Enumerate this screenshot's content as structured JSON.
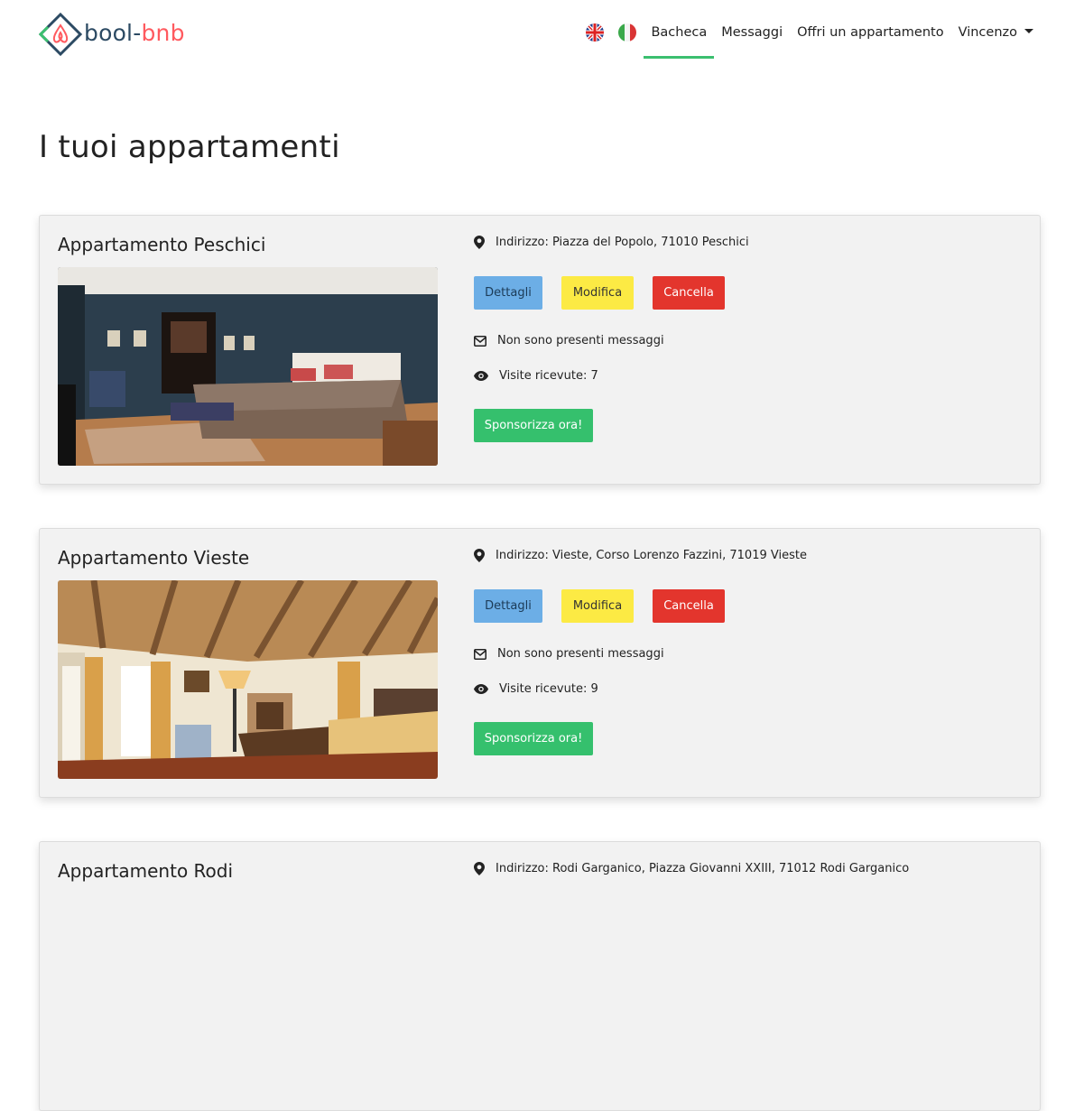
{
  "brand": {
    "part1": "bool",
    "dash": "-",
    "part2": "bnb"
  },
  "nav": {
    "flag_en": "uk-flag",
    "flag_it": "italy-flag",
    "bacheca": "Bacheca",
    "messaggi": "Messaggi",
    "offri": "Offri un appartamento",
    "user": "Vincenzo"
  },
  "page_title": "I tuoi appartamenti",
  "buttons": {
    "details": "Dettagli",
    "edit": "Modifica",
    "delete": "Cancella",
    "sponsor": "Sponsorizza ora!"
  },
  "apartments": [
    {
      "title": "Appartamento Peschici",
      "address": "Indirizzo: Piazza del Popolo, 71010 Peschici",
      "messages": "Non sono presenti messaggi",
      "visits": "Visite ricevute: 7"
    },
    {
      "title": "Appartamento Vieste",
      "address": "Indirizzo: Vieste, Corso Lorenzo Fazzini, 71019 Vieste",
      "messages": "Non sono presenti messaggi",
      "visits": "Visite ricevute: 9"
    },
    {
      "title": "Appartamento Rodi",
      "address": "Indirizzo: Rodi Garganico, Piazza Giovanni XXIII, 71012 Rodi Garganico",
      "messages": "",
      "visits": ""
    }
  ],
  "colors": {
    "brand_dark": "#2c4a63",
    "brand_red": "#ff5a5f",
    "active_underline": "#3bbf6f",
    "details_btn": "#6caee6",
    "edit_btn": "#fcea44",
    "delete_btn": "#e3352d",
    "sponsor_btn": "#35c06d"
  }
}
